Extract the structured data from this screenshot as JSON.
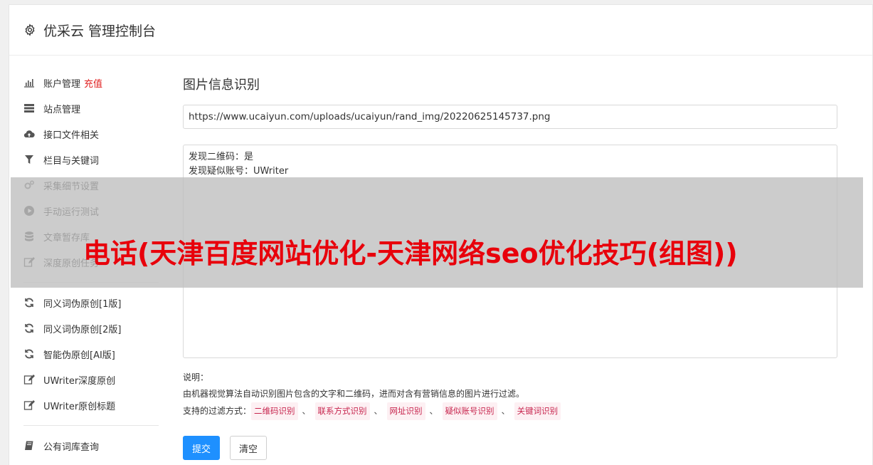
{
  "header": {
    "title": "优采云 管理控制台"
  },
  "sidebar": {
    "group1": [
      {
        "label": "账户管理",
        "icon": "bar-chart-icon",
        "extra": "充值"
      },
      {
        "label": "站点管理",
        "icon": "server-icon"
      },
      {
        "label": "接口文件相关",
        "icon": "cloud-upload-icon"
      },
      {
        "label": "栏目与关键词",
        "icon": "filter-icon"
      },
      {
        "label": "采集细节设置",
        "icon": "gears-icon"
      },
      {
        "label": "手动运行测试",
        "icon": "play-circle-icon"
      },
      {
        "label": "文章暂存库",
        "icon": "database-icon"
      },
      {
        "label": "深度原创任务",
        "icon": "edit-icon"
      }
    ],
    "group2": [
      {
        "label": "同义词伪原创[1版]",
        "icon": "refresh-icon"
      },
      {
        "label": "同义词伪原创[2版]",
        "icon": "refresh-icon"
      },
      {
        "label": "智能伪原创[AI版]",
        "icon": "refresh-icon"
      },
      {
        "label": "UWriter深度原创",
        "icon": "edit-icon"
      },
      {
        "label": "UWriter原创标题",
        "icon": "edit-icon"
      }
    ],
    "group3": [
      {
        "label": "公有词库查询",
        "icon": "book-icon"
      }
    ]
  },
  "main": {
    "title": "图片信息识别",
    "url_value": "https://www.ucaiyun.com/uploads/ucaiyun/rand_img/20220625145737.png",
    "result_text": "发现二维码：是\n发现疑似账号：UWriter",
    "desc_label": "说明：",
    "desc_text": "由机器视觉算法自动识别图片包含的文字和二维码，进而对含有营销信息的图片进行过滤。",
    "filter_label": "支持的过滤方式：",
    "filters": [
      "二维码识别",
      "联系方式识别",
      "网址识别",
      "疑似账号识别",
      "关键词识别"
    ],
    "filter_sep": "、",
    "submit_label": "提交",
    "clear_label": "清空"
  },
  "overlay": {
    "text": "电话(天津百度网站优化-天津网络seo优化技巧(组图))"
  },
  "colors": {
    "primary": "#1e90ff",
    "danger": "#e02020",
    "tag_text": "#c7254e",
    "tag_bg": "#fdf0f3"
  }
}
